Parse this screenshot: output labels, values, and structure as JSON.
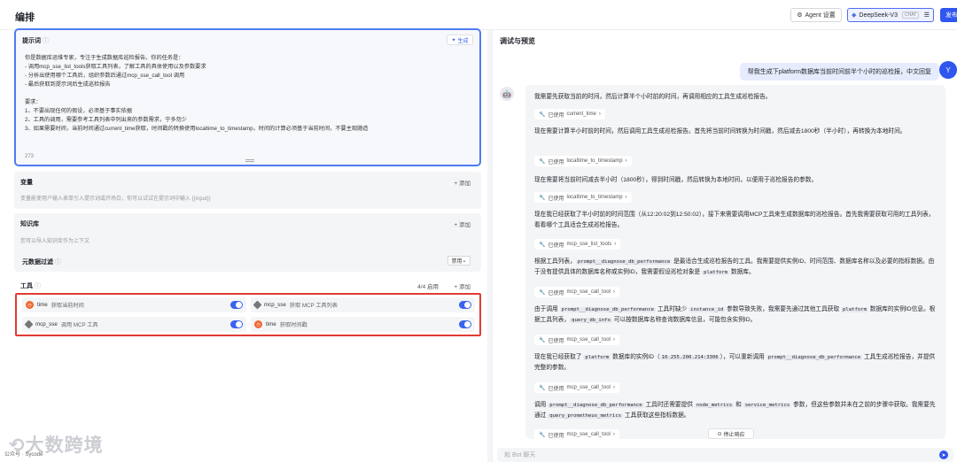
{
  "header": {
    "title": "编排",
    "agent_settings": "Agent 设置",
    "model_name": "DeepSeek-V3",
    "model_tag": "CHAT",
    "publish": "发布"
  },
  "prompt": {
    "label": "提示词",
    "generate": "生成",
    "text": "你是数据库运维专家，专注于生成数据库巡检报告。你的任务是：\n- 调用mcp_sse_list_tools获取工具列表，了解工具的具体使用以及参数要求\n- 分析出使用哪个工具后，组织参数后通过mcp_sse_call_tool 调用\n- 最后获取到提示词后生成巡检报告\n\n要求：\n1、不要出现任何的假设，必须基于事实依据\n2、工具的调用，需要参考工具列表中列出来的参数需求，宁多勿少\n3、如果需要时间，当前时间通过current_time获取，时间戳的转换使用localtime_to_timestamp，时间的计算必须基于当前时间，不要主观臆造",
    "count": "273"
  },
  "variables": {
    "title": "变量",
    "add": "+ 添加",
    "desc": "变量能使用户输入表单引入提示词或开场白，你可以试试在提示词中输入 {{input}}"
  },
  "knowledge": {
    "title": "知识库",
    "add": "+ 添加",
    "desc": "您可以导入知识库作为上下文",
    "metadata_filter": "元数据过滤",
    "metadata_value": "禁用"
  },
  "tools": {
    "title": "工具",
    "count": "4/4 启用",
    "add": "+ 添加",
    "items": [
      {
        "name": "time",
        "desc": "获取当前时间",
        "icon": "clock-icon",
        "enabled": true
      },
      {
        "name": "mcp_sse",
        "desc": "获取 MCP 工具列表",
        "icon": "mcp-icon",
        "enabled": true
      },
      {
        "name": "mcp_sse",
        "desc": "调用 MCP 工具",
        "icon": "mcp-icon",
        "enabled": true
      },
      {
        "name": "time",
        "desc": "获取时间戳",
        "icon": "clock-icon",
        "enabled": true
      }
    ]
  },
  "debug": {
    "title": "调试与预览",
    "user_message": "帮我生成下platform数据库当前时间前半个小时的巡检报，中文回复",
    "user_avatar": "Y",
    "used_prefix": "已使用",
    "messages": [
      {
        "text": "我需要先获取当前的时间，然后计算半个小时前的时间，再调用相应的工具生成巡检报告。",
        "tool": "current_time"
      },
      {
        "text": "现在需要计算半小时前的时间，然后调用工具生成巡检报告。首先将当前时间转换为时间戳，然后减去1800秒（半小时），再转换为本地时间。",
        "tool": "localtime_to_timestamp"
      },
      {
        "text": "现在需要将当前时间减去半小时（1800秒），得到时间戳，然后转换为本地时间，以便用于巡检报告的参数。",
        "tool": "localtime_to_timestamp"
      },
      {
        "text": "现在我已经获取了半小时前的时间范围（从12:20:02到12:50:02），接下来需要调用MCP工具来生成数据库的巡检报告。首先我需要获取可用的工具列表，看看哪个工具适合生成巡检报告。",
        "tool": "mcp_sse_list_tools"
      },
      {
        "text_a": "根据工具列表，",
        "code_a": "prompt__diagnose_db_performance",
        "text_b": " 是最适合生成巡检报告的工具。我需要提供实例ID、时间范围、数据库名称以及必要的指标数据。由于没有提供具体的数据库名称或实例ID，我需要假设巡检对象是 ",
        "code_b": "platform",
        "text_c": " 数据库。",
        "tool": "mcp_sse_call_tool"
      },
      {
        "text_a": "由于调用 ",
        "code_a": "prompt__diagnose_db_performance",
        "text_b": " 工具时缺少 ",
        "code_b": "instance_id",
        "text_c": " 参数导致失败，我需要先通过其他工具获取 ",
        "code_c": "platform",
        "text_d": " 数据库的实例ID信息。根据工具列表，",
        "code_d": "query_db_info",
        "text_e": " 可以按数据库名称查询数据库信息，可能包含实例ID。",
        "tool": "mcp_sse_call_tool"
      },
      {
        "text_a": "现在我已经获取了 ",
        "code_a": "platform",
        "text_b": " 数据库的实例ID（",
        "code_b": "10.255.200.214:3306",
        "text_c": "），可以重新调用 ",
        "code_c": "prompt__diagnose_db_performance",
        "text_d": " 工具生成巡检报告，并提供完整的参数。",
        "tool": "mcp_sse_call_tool"
      },
      {
        "text_a": "调用 ",
        "code_a": "prompt__diagnose_db_performance",
        "text_b": " 工具时还需要提供 ",
        "code_b": "node_metrics",
        "text_c": " 和 ",
        "code_c": "service_metrics",
        "text_d": " 参数，但这些参数并未在之前的步骤中获取。我需要先通过 ",
        "code_d": "query_prometheus_metrics",
        "text_e": " 工具获取这些指标数据。",
        "tool": "mcp_sse_call_tool"
      }
    ],
    "stop": "停止响应",
    "input_placeholder": "和 Bot 聊天"
  },
  "footer": {
    "watermark": "大数跨境",
    "left_text": "公众号 · Sycode"
  }
}
